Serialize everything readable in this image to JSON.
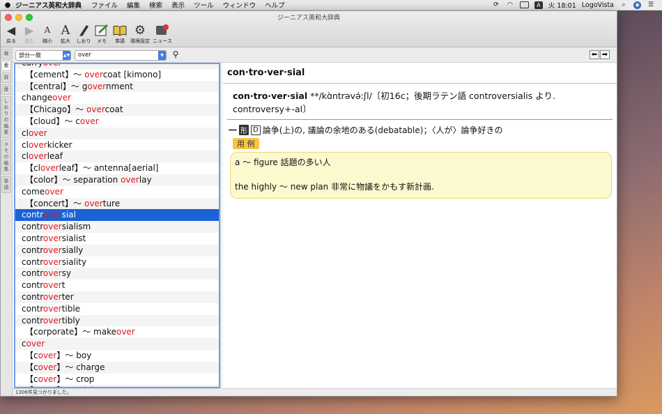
{
  "menubar": {
    "app_name": "ジーニアス英和大辞典",
    "items": [
      "ファイル",
      "編集",
      "検索",
      "表示",
      "ツール",
      "ウィンドウ",
      "ヘルプ"
    ],
    "right": {
      "clock": "火 18:01",
      "user": "LogoVista"
    }
  },
  "window": {
    "title": "ジーニアス英和大辞典"
  },
  "toolbar": {
    "buttons": [
      {
        "label": "戻る",
        "icon": "back-arrow-icon"
      },
      {
        "label": "進む",
        "icon": "forward-arrow-icon"
      },
      {
        "label": "縮小",
        "icon": "shrink-font-icon"
      },
      {
        "label": "拡大",
        "icon": "enlarge-font-icon"
      },
      {
        "label": "しおり",
        "icon": "bookmark-icon"
      },
      {
        "label": "メモ",
        "icon": "memo-icon"
      },
      {
        "label": "単語",
        "icon": "wordbook-icon"
      },
      {
        "label": "環境設定",
        "icon": "gear-icon"
      },
      {
        "label": "ニュース",
        "icon": "news-icon"
      }
    ]
  },
  "tabs": [
    "検",
    "索",
    "辞",
    "歴",
    "しおりの編集",
    "メモの編集",
    "単語"
  ],
  "search": {
    "mode": "部分一致",
    "query": "over"
  },
  "results": [
    {
      "pre": "carry",
      "hl": "over",
      "post": "",
      "indent": false
    },
    {
      "pre": "【cement】～ ",
      "hl": "over",
      "post": "coat [kimono]",
      "indent": true
    },
    {
      "pre": "【central】～ g",
      "hl": "over",
      "post": "nment",
      "indent": true
    },
    {
      "pre": "change",
      "hl": "over",
      "post": "",
      "indent": false
    },
    {
      "pre": "【Chicago】～ ",
      "hl": "over",
      "post": "coat",
      "indent": true
    },
    {
      "pre": "【cloud】～ c",
      "hl": "over",
      "post": "",
      "indent": true
    },
    {
      "pre": "cl",
      "hl": "over",
      "post": "",
      "indent": false
    },
    {
      "pre": "cl",
      "hl": "over",
      "post": "kicker",
      "indent": false
    },
    {
      "pre": "cl",
      "hl": "over",
      "post": "leaf",
      "indent": false
    },
    {
      "pre": "【cl",
      "hl": "over",
      "post": "leaf】～ antenna[aerial]",
      "indent": true
    },
    {
      "pre": "【color】～ separation ",
      "hl": "over",
      "post": "lay",
      "indent": true
    },
    {
      "pre": "come",
      "hl": "over",
      "post": "",
      "indent": false
    },
    {
      "pre": "【concert】～ ",
      "hl": "over",
      "post": "ture",
      "indent": true
    },
    {
      "pre": "contr",
      "hl": "over",
      "post": "sial",
      "indent": false,
      "selected": true
    },
    {
      "pre": "contr",
      "hl": "over",
      "post": "sialism",
      "indent": false
    },
    {
      "pre": "contr",
      "hl": "over",
      "post": "sialist",
      "indent": false
    },
    {
      "pre": "contr",
      "hl": "over",
      "post": "sially",
      "indent": false
    },
    {
      "pre": "contr",
      "hl": "over",
      "post": "siality",
      "indent": false
    },
    {
      "pre": "contr",
      "hl": "over",
      "post": "sy",
      "indent": false
    },
    {
      "pre": "contr",
      "hl": "over",
      "post": "t",
      "indent": false
    },
    {
      "pre": "contr",
      "hl": "over",
      "post": "ter",
      "indent": false
    },
    {
      "pre": "contr",
      "hl": "over",
      "post": "tible",
      "indent": false
    },
    {
      "pre": "contr",
      "hl": "over",
      "post": "tibly",
      "indent": false
    },
    {
      "pre": "【corporate】～ make",
      "hl": "over",
      "post": "",
      "indent": true
    },
    {
      "pre": "c",
      "hl": "over",
      "post": "",
      "indent": false
    },
    {
      "pre": "【c",
      "hl": "over",
      "post": "】～ boy",
      "indent": true
    },
    {
      "pre": "【c",
      "hl": "over",
      "post": "】～ charge",
      "indent": true
    },
    {
      "pre": "【c",
      "hl": "over",
      "post": "】～ crop",
      "indent": true
    },
    {
      "pre": "【c",
      "hl": "over",
      "post": "】～ cricket",
      "indent": true
    }
  ],
  "status": "1306件見つかりました。",
  "entry": {
    "headword_bar": "con·tro·ver·sial",
    "headword": "con·tro·ver·sial",
    "pron": " **/kɑ̀ntrəvə́ːʃl/〔初16c；後期ラテン語 controversialis より. controversy+-al〕",
    "pos": "形",
    "d_mark": "D",
    "definition": "論争(上)の, 議論の余地のある(debatable)；〈人が〉論争好きの",
    "example_label": "用 例",
    "examples": [
      "a ～ figure 話題の多い人",
      "the highly ～ new plan 非常に物議をかもす新計画."
    ]
  }
}
